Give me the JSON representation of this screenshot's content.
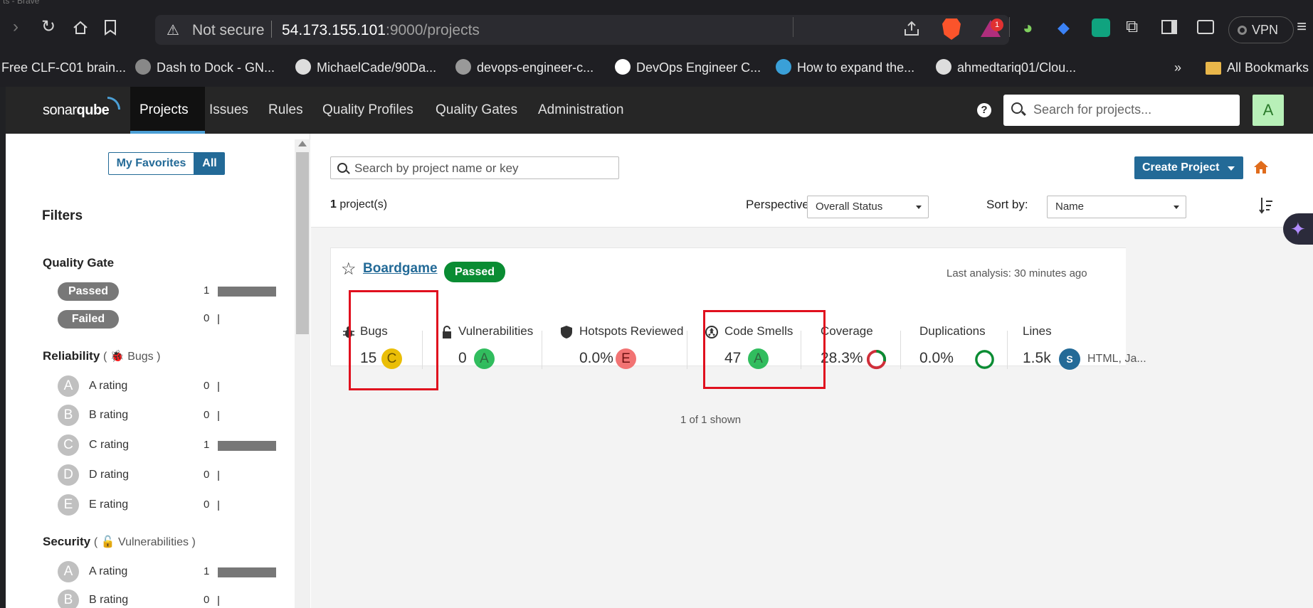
{
  "browser": {
    "title_fragment": "ts - Brave",
    "url": {
      "warning": "Not secure",
      "host": "54.173.155.101",
      "path": ":9000/projects"
    },
    "notification_count": "1",
    "vpn_label": "VPN",
    "bookmarks": [
      "Free CLF-C01 brain...",
      "Dash to Dock - GN...",
      "MichaelCade/90Da...",
      "devops-engineer-c...",
      "DevOps Engineer C...",
      "How to expand the...",
      "ahmedtariq01/Clou..."
    ],
    "more_bookmarks": "»",
    "all_bookmarks": "All Bookmarks"
  },
  "nav": {
    "logo_light": "sonar",
    "logo_bold": "qube",
    "items": [
      "Projects",
      "Issues",
      "Rules",
      "Quality Profiles",
      "Quality Gates",
      "Administration"
    ],
    "help": "?",
    "search_placeholder": "Search for projects...",
    "avatar_letter": "A"
  },
  "sidebar": {
    "toggle": {
      "favorites": "My Favorites",
      "all": "All"
    },
    "filters_title": "Filters",
    "quality_gate": {
      "title": "Quality Gate",
      "items": [
        {
          "label": "Passed",
          "count": "1",
          "fraction": 1.0
        },
        {
          "label": "Failed",
          "count": "0",
          "fraction": 0.0
        }
      ]
    },
    "reliability": {
      "title": "Reliability",
      "sub": "Bugs",
      "items": [
        {
          "letter": "A",
          "label": "A rating",
          "count": "0",
          "fraction": 0.0
        },
        {
          "letter": "B",
          "label": "B rating",
          "count": "0",
          "fraction": 0.0
        },
        {
          "letter": "C",
          "label": "C rating",
          "count": "1",
          "fraction": 1.0
        },
        {
          "letter": "D",
          "label": "D rating",
          "count": "0",
          "fraction": 0.0
        },
        {
          "letter": "E",
          "label": "E rating",
          "count": "0",
          "fraction": 0.0
        }
      ]
    },
    "security": {
      "title": "Security",
      "sub": "Vulnerabilities",
      "items": [
        {
          "letter": "A",
          "label": "A rating",
          "count": "1",
          "fraction": 1.0
        },
        {
          "letter": "B",
          "label": "B rating",
          "count": "0",
          "fraction": 0.0
        }
      ]
    }
  },
  "main": {
    "search_placeholder": "Search by project name or key",
    "create_project": "Create Project",
    "project_count": "1",
    "project_count_suffix": " project(s)",
    "perspective_label": "Perspective:",
    "perspective_value": "Overall Status",
    "sort_label": "Sort by:",
    "sort_value": "Name",
    "shown": "1 of 1 shown"
  },
  "project": {
    "name": "Boardgame",
    "status": "Passed",
    "last_analysis": "Last analysis: 30 minutes ago",
    "metrics": {
      "bugs": {
        "label": "Bugs",
        "value": "15",
        "grade": "C"
      },
      "vulnerabilities": {
        "label": "Vulnerabilities",
        "value": "0",
        "grade": "A"
      },
      "hotspots": {
        "label": "Hotspots Reviewed",
        "value": "0.0%",
        "grade": "E"
      },
      "code_smells": {
        "label": "Code Smells",
        "value": "47",
        "grade": "A"
      },
      "coverage": {
        "label": "Coverage",
        "value": "28.3%",
        "fraction": 0.283
      },
      "duplications": {
        "label": "Duplications",
        "value": "0.0%",
        "fraction": 0.0
      },
      "lines": {
        "label": "Lines",
        "value": "1.5k",
        "lang_badge": "S",
        "languages": "HTML, Ja..."
      }
    }
  },
  "colors": {
    "accent": "#236a97",
    "passed": "#0a8c33",
    "highlight": "#e0101e"
  }
}
